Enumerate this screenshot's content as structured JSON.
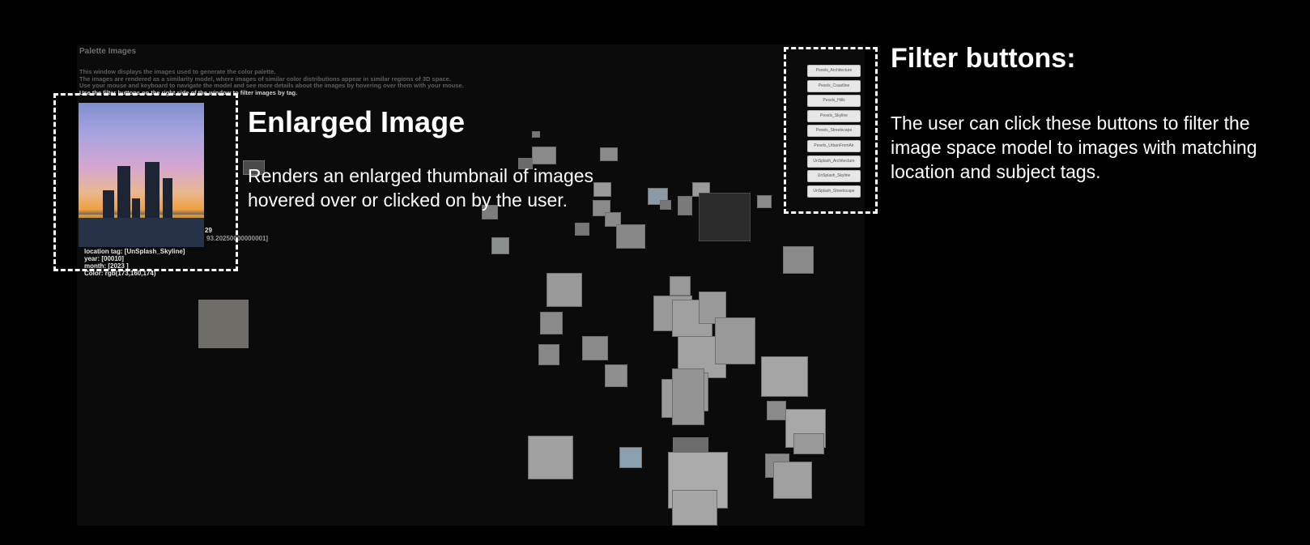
{
  "window": {
    "title": "Palette Images",
    "description": [
      "This window displays the images used to generate the color palette.",
      "The images are rendered as a similarity model, where images of similar color distributions appear in similar regions of 3D space.",
      "Use your mouse and keyboard to navigate the model and see more details about the images by hovering over them with your mouse.",
      "Use the filter buttons on the right side of the window to filter images by tag."
    ]
  },
  "enlarged_image": {
    "meta_a": "29",
    "meta_b": "93.20250000000001]",
    "meta_lines": [
      "location tag: [UnSplash_Skyline]",
      "year: [00010]",
      "month: [2023 ]",
      "Color: rgb(173,160,174)"
    ]
  },
  "filters": [
    "Pexels_Architecture",
    "Pexels_Coastline",
    "Pexels_Hills",
    "Pexels_Skyline",
    "Pexels_Streetscape",
    "Pexels_UrbanFromAir",
    "UnSplash_Architecture",
    "UnSplash_Skyline",
    "UnSplash_Streetscape"
  ],
  "annotations": {
    "enlarged": {
      "title": "Enlarged Image",
      "text_lines": [
        "Renders an enlarged thumbnail of images",
        "hovered over or clicked on by the user."
      ]
    },
    "filter": {
      "title": "Filter buttons:",
      "text_lines": [
        "The user can click these buttons to filter the",
        "image space model to images with matching",
        "location and subject tags."
      ]
    }
  },
  "colors": {
    "background": "#000000",
    "viewport": "#0b0b0b",
    "annotation": "#ffffff",
    "tile": "#888888"
  }
}
